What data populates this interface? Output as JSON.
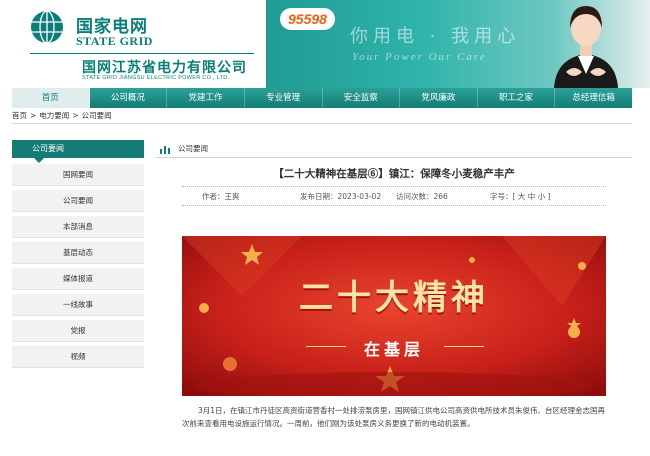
{
  "header": {
    "logo_cn": "国家电网",
    "logo_en": "STATE GRID",
    "company_cn": "国网江苏省电力有限公司",
    "company_en": "STATE GRID JIANGSU ELECTRIC POWER CO., LTD.",
    "hotline": "95598",
    "slogan_cn": "你用电 · 我用心",
    "slogan_en": "Your Power  Our Care"
  },
  "nav": {
    "items": [
      "首页",
      "公司概况",
      "党建工作",
      "专业管理",
      "安全监察",
      "党风廉政",
      "职工之家",
      "总经理信箱"
    ],
    "active_index": 0
  },
  "breadcrumb": {
    "items": [
      "首页",
      ">",
      "电力要闻",
      ">",
      "公司要闻"
    ]
  },
  "sidebar": {
    "heading": "公司要闻",
    "items": [
      "国网要闻",
      "公司要闻",
      "本部消息",
      "基层动态",
      "媒体报道",
      "一线故事",
      "党报",
      "视频"
    ]
  },
  "section": {
    "title": "公司要闻"
  },
  "article": {
    "title": "【二十大精神在基层⑥】镇江：保障冬小麦稳产丰产",
    "author_label": "作者：王爽",
    "date_label": "发布日期：2023-03-02",
    "views_label": "访问次数：266",
    "fontsize_label": "字号：[ 大 中 小 ]",
    "image_headline": "二十大精神",
    "image_subline": "在基层",
    "body": "3月1日，在镇江市丹徒区高资街道营香村一处排涝泵房里，国网镇江供电公司高资供电所技术员朱俊伟、台区经理金志国再次前来查看用电设施运行情况。一周前，他们刚为该处泵房义务更换了新的电动机装置。"
  },
  "colors": {
    "brand": "#137d75",
    "accent": "#e9630a",
    "banner_red": "#c8201a"
  }
}
